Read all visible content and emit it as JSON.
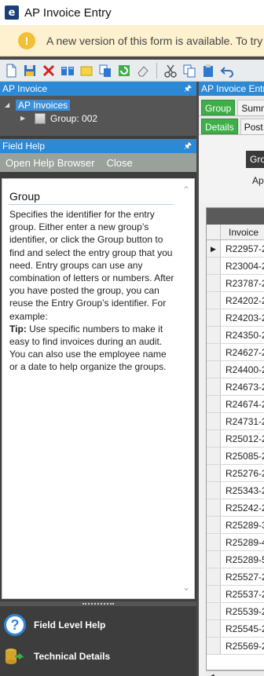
{
  "window": {
    "title": "AP Invoice Entry",
    "logo_letter": "e"
  },
  "banner": {
    "message": "A new version of this form is available. To try"
  },
  "toolbar": {
    "icons": [
      "new-document-icon",
      "save-icon",
      "delete-icon",
      "open-book-icon",
      "note-icon",
      "copy-icon",
      "refresh-icon",
      "eraser-icon",
      "cut-icon",
      "copy-icon",
      "paste-icon",
      "undo-icon"
    ]
  },
  "ap_invoice_pane": {
    "title": "AP Invoice",
    "tree": {
      "root_label": "AP Invoices",
      "child_label": "Group: 002"
    }
  },
  "field_help": {
    "title": "Field Help",
    "menu": [
      "Open Help Browser",
      "Close"
    ],
    "heading": "Group",
    "body": "Specifies the identifier for the entry group. Either enter a new group’s identifier, or click the Group button to find and select the entry group that you need. Entry groups can use any combination of letters or numbers. After you have posted the group, you can reuse the Entry Group’s identifier. For example:",
    "tip_label": "Tip:",
    "tip_text": " Use specific numbers to make it easy to find invoices during an audit. You can also use the employee name or a date to help organize the groups."
  },
  "bottom_links": {
    "field_level_help": "Field Level Help",
    "technical_details": "Technical Details"
  },
  "entry_pane": {
    "title": "AP Invoice Entry",
    "tabs_row1": [
      "Group",
      "Summary"
    ],
    "tabs_row2": [
      "Details",
      "Post"
    ],
    "group_button": "Group",
    "ap_label": "Ap",
    "grid_header": "Invoice",
    "rows": [
      "R22957-2",
      "R23004-2",
      "R23787-2",
      "R24202-2",
      "R24203-2",
      "R24350-2",
      "R24627-2",
      "R24400-2",
      "R24673-2",
      "R24674-2",
      "R24731-2",
      "R25012-2",
      "R25085-2",
      "R25276-2",
      "R25343-2",
      "R25242-2",
      "R25289-3",
      "R25289-4",
      "R25289-5",
      "R25527-2",
      "R25537-2",
      "R25539-2",
      "R25545-2",
      "R25569-2"
    ]
  },
  "colors": {
    "accent_blue": "#2c89d6",
    "tab_green": "#3fae49",
    "banner_bg": "#fdf1cf"
  }
}
